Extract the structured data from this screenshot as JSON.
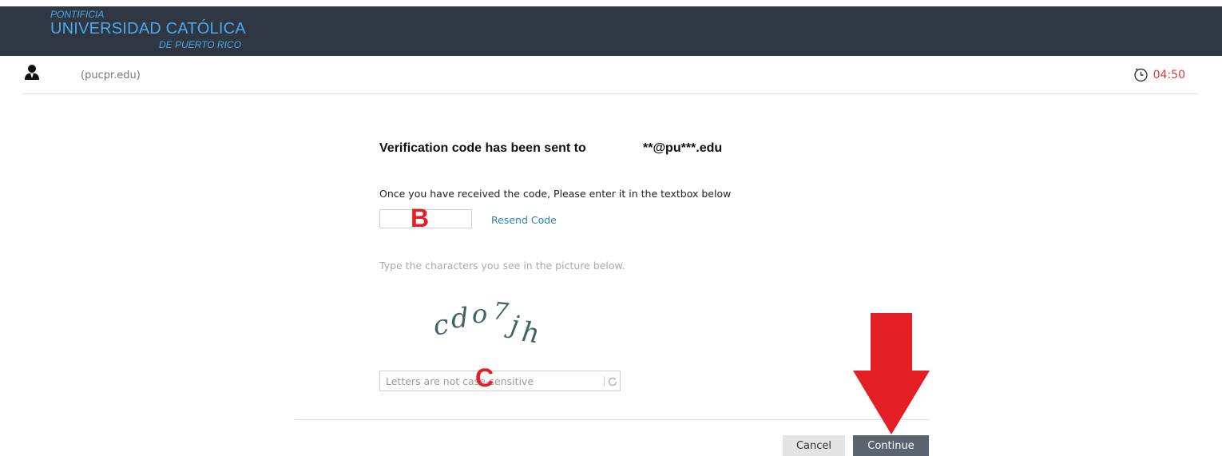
{
  "logo": {
    "line1": "PONTIFICIA",
    "line2": "UNIVERSIDAD CATÓLICA",
    "line3": "DE PUERTO RICO"
  },
  "user": {
    "icon": "user-icon",
    "domain": "(pucpr.edu)"
  },
  "timer": {
    "icon": "clock-icon",
    "value": "04:50",
    "color": "#e03a2f"
  },
  "verification": {
    "heading": "Verification code has been sent to",
    "masked_email": "**@pu***.edu",
    "instruction": "Once you have received the code, Please enter it in the textbox below",
    "code_value": "",
    "resend_label": "Resend Code"
  },
  "captcha": {
    "prompt": "Type the characters you see in the picture below.",
    "image_text": "cdo7jh",
    "input_placeholder": "Letters are not case-sensitive",
    "input_value": "",
    "refresh_icon": "refresh-icon"
  },
  "actions": {
    "cancel_label": "Cancel",
    "continue_label": "Continue"
  },
  "annotations": {
    "mark_b": "B",
    "mark_c": "C",
    "arrow_color": "#e31e24"
  },
  "colors": {
    "header_bg": "#2f3742",
    "logo_blue": "#4da7e8",
    "link_blue": "#2a7fc1",
    "continue_bg": "#5a6370"
  }
}
